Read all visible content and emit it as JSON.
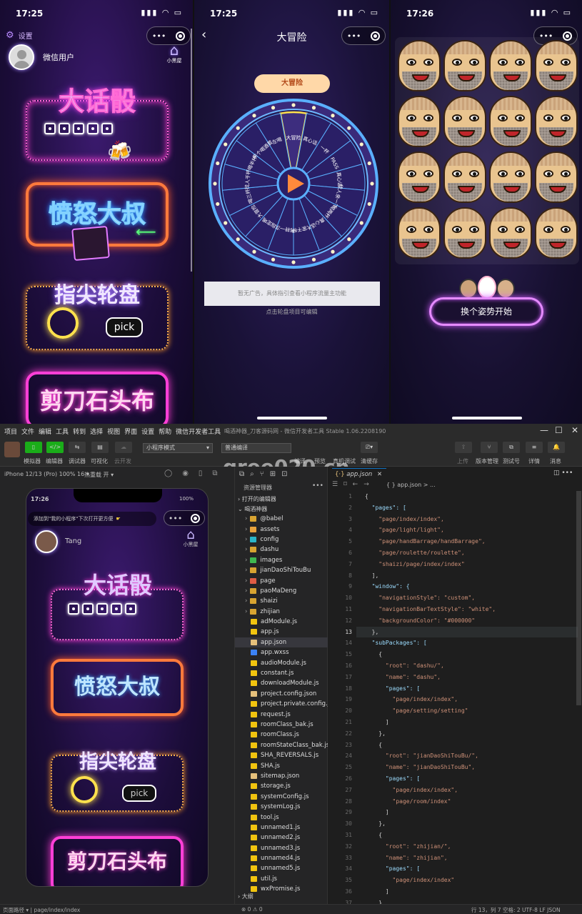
{
  "panel1": {
    "time": "17:25",
    "settings_label": "设置",
    "user_name": "微信用户",
    "home_label": "小黑屋",
    "cards": [
      "大话骰",
      "愤怒大叔",
      "指尖轮盘",
      "剪刀石头布"
    ],
    "pick_label": "pick"
  },
  "panel2": {
    "time": "17:25",
    "title": "大冒险",
    "pointer_label": "大冒险",
    "segments": [
      "大冒险",
      "真心话",
      "一杯",
      "PASS",
      "真心话",
      "找人亲一下",
      "喝两杯",
      "真心话",
      "大家干杯",
      "再转一次",
      "指定喝",
      "大冒险",
      "喝三杯",
      "找人干杯",
      "喝半杯",
      "来个喝酒套",
      "左喝"
    ],
    "ad_text": "暂无广告，具体指引查看小程序流量主功能",
    "hint_text": "点击轮盘项目可编辑"
  },
  "panel3": {
    "time": "17:26",
    "start_button": "换个姿势开始"
  },
  "ide": {
    "menu": [
      "项目",
      "文件",
      "编辑",
      "工具",
      "转到",
      "选择",
      "视图",
      "界面",
      "设置",
      "帮助",
      "微信开发者工具"
    ],
    "window_title": "喝酒神器_刀客源码网 - 微信开发者工具 Stable 1.06.2208190",
    "watermark": "gree020.cn",
    "toolbar_left": [
      "模拟器",
      "编辑器",
      "调试器",
      "可视化",
      "云开发"
    ],
    "mode_select": "小程序模式",
    "compile_select": "普通编译",
    "toolbar_mid": [
      "编译",
      "预览",
      "真机调试",
      "清缓存"
    ],
    "toolbar_right": [
      "上传",
      "版本管理",
      "测试号",
      "详情",
      "消息"
    ],
    "device": "iPhone 12/13 (Pro) 100% 16 ▾",
    "hotreload": "热重载 开 ▾",
    "sim": {
      "time": "17:26",
      "battery": "100%",
      "tip": "添加到\"我的小程序\"下次打开更方便",
      "user": "Tang",
      "home": "小黑屋"
    },
    "explorer_title": "资源管理器",
    "open_editors": "打开的编辑器",
    "project": "喝酒神器",
    "files": [
      "@babel",
      "assets",
      "config",
      "dashu",
      "images",
      "jianDaoShiTouBu",
      "page",
      "paoMaDeng",
      "shaizi",
      "zhijian",
      "adModule.js",
      "app.js",
      "app.json",
      "app.wxss",
      "audioModule.js",
      "constant.js",
      "downloadModule.js",
      "project.config.json",
      "project.private.config.js...",
      "request.js",
      "roomClass_bak.js",
      "roomClass.js",
      "roomStateClass_bak.js",
      "SHA_REVERSALS.js",
      "SHA.js",
      "sitemap.json",
      "storage.js",
      "systemConfig.js",
      "systemLog.js",
      "tool.js",
      "unnamed1.js",
      "unnamed2.js",
      "unnamed3.js",
      "unnamed4.js",
      "unnamed5.js",
      "util.js",
      "wxPromise.js"
    ],
    "outline": "大纲",
    "tab": "app.json",
    "breadcrumb": "{ } app.json > ...",
    "code": [
      "{",
      "  \"pages\": [",
      "    \"page/index/index\",",
      "    \"page/light/light\",",
      "    \"page/handBarrage/handBarrage\",",
      "    \"page/roulette/roulette\",",
      "    \"shaizi/page/index/index\"",
      "  ],",
      "  \"window\": {",
      "    \"navigationStyle\": \"custom\",",
      "    \"navigationBarTextStyle\": \"white\",",
      "    \"backgroundColor\": \"#000000\"",
      "  },",
      "  \"subPackages\": [",
      "    {",
      "      \"root\": \"dashu/\",",
      "      \"name\": \"dashu\",",
      "      \"pages\": [",
      "        \"page/index/index\",",
      "        \"page/setting/setting\"",
      "      ]",
      "    },",
      "    {",
      "      \"root\": \"jianDaoShiTouBu/\",",
      "      \"name\": \"jianDaoShiTouBu\",",
      "      \"pages\": [",
      "        \"page/index/index\",",
      "        \"page/room/index\"",
      "      ]",
      "    },",
      "    {",
      "      \"root\": \"zhijian/\",",
      "      \"name\": \"zhijian\",",
      "      \"pages\": [",
      "        \"page/index/index\"",
      "      ]",
      "    }"
    ],
    "line_numbers": [
      "1",
      "2",
      "3",
      "4",
      "5",
      "6",
      "7",
      "8",
      "9",
      "10",
      "11",
      "12",
      "13",
      "14",
      "15",
      "16",
      "17",
      "18",
      "19",
      "20",
      "21",
      "22",
      "23",
      "24",
      "25",
      "26",
      "27",
      "28",
      "29",
      "30",
      "31",
      "32",
      "33",
      "34",
      "35",
      "36",
      "37"
    ],
    "footer_left": "页面路径 ▾ | page/index/index",
    "footer_problems": "⊗ 0 ⚠ 0",
    "footer_right": "行 13，列 7  空格: 2  UTF-8  LF  JSON"
  },
  "colors": {
    "neon_pink": "#ff3fd7",
    "neon_orange": "#ff7a3c",
    "neon_yellow": "#ffe14d",
    "ide_bg": "#1e1e1e"
  }
}
